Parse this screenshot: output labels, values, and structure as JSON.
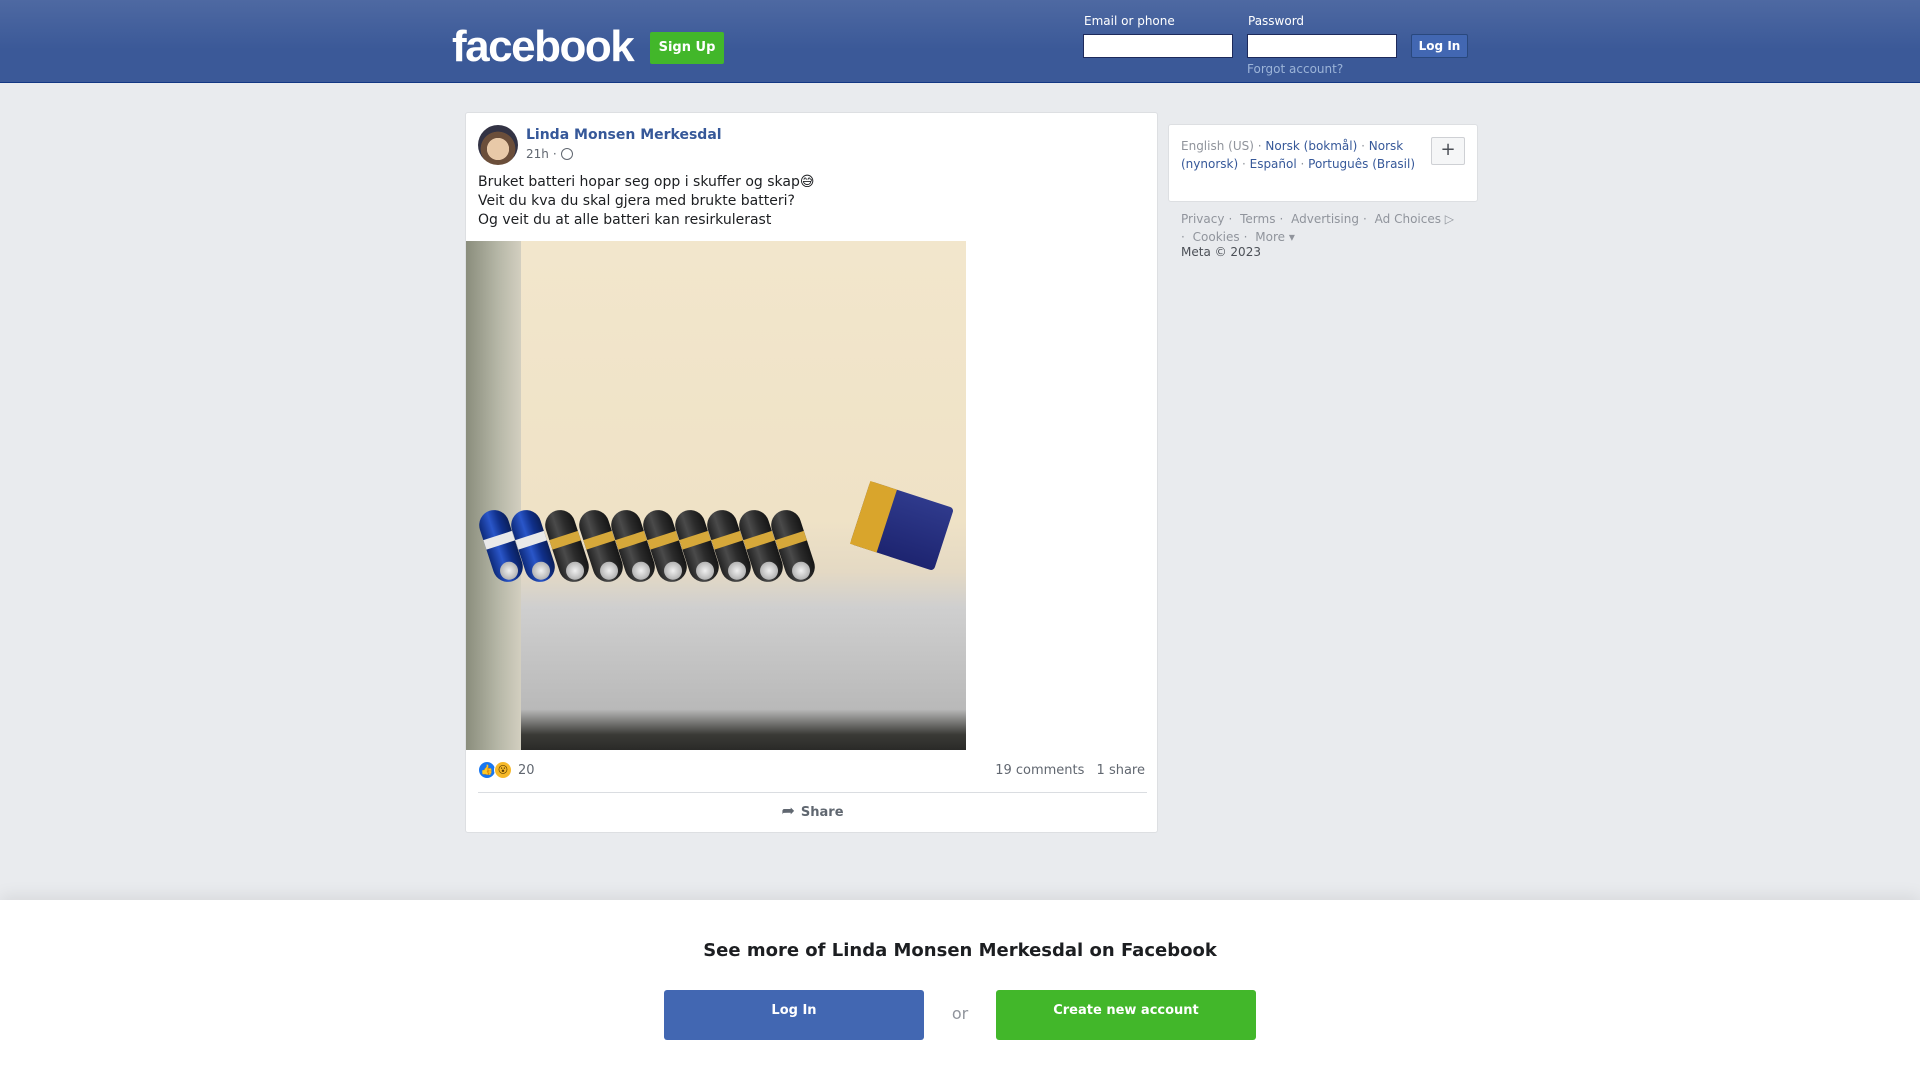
{
  "header": {
    "logo": "facebook",
    "signup_label": "Sign Up",
    "email_label": "Email or phone",
    "password_label": "Password",
    "login_label": "Log In",
    "forgot_label": "Forgot account?"
  },
  "post": {
    "author": "Linda Monsen Merkesdal",
    "time": "21h",
    "separator": "·",
    "text_lines": [
      "Bruket batteri hopar seg opp i skuffer og skap😅",
      "Veit du kva du skal gjera med brukte batteri?",
      "Og veit du at alle batteri kan resirkulerast"
    ],
    "reaction_count": "20",
    "comments": "19 comments",
    "shares": "1 share",
    "share_label": "Share"
  },
  "sidebar": {
    "languages": {
      "current": "English (US)",
      "others": [
        "Norsk (bokmål)",
        "Norsk (nynorsk)",
        "Español",
        "Português (Brasil)"
      ]
    },
    "add_language": "+",
    "footer_links": [
      "Privacy",
      "Terms",
      "Advertising",
      "Ad Choices",
      "Cookies",
      "More"
    ],
    "copyright": "Meta © 2023"
  },
  "banner": {
    "title": "See more of Linda Monsen Merkesdal on Facebook",
    "login_label": "Log In",
    "or_label": "or",
    "create_label": "Create new account"
  },
  "colors": {
    "brand_blue": "#3b5998",
    "green": "#42b72a",
    "link": "#365899"
  }
}
